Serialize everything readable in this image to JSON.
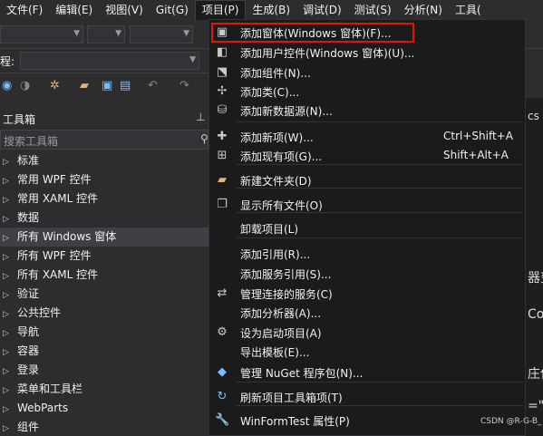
{
  "menubar": {
    "items": [
      "文件(F)",
      "编辑(E)",
      "视图(V)",
      "Git(G)",
      "项目(P)",
      "生成(B)",
      "调试(D)",
      "测试(S)",
      "分析(N)",
      "工具("
    ]
  },
  "toolbar2": {
    "label": "程:"
  },
  "toolbox": {
    "title": "工具箱",
    "search_placeholder": "搜索工具箱",
    "items": [
      "标准",
      "常用 WPF 控件",
      "常用 XAML 控件",
      "数据",
      "所有 Windows 窗体",
      "所有 WPF 控件",
      "所有 XAML 控件",
      "验证",
      "公共控件",
      "导航",
      "容器",
      "登录",
      "菜单和工具栏",
      "WebParts",
      "组件"
    ],
    "selected_index": 4
  },
  "project_menu": {
    "items": [
      {
        "label": "添加窗体(Windows 窗体)(F)...",
        "icon": "add-form-icon",
        "shortcut": ""
      },
      {
        "label": "添加用户控件(Windows 窗体)(U)...",
        "icon": "add-user-control-icon",
        "shortcut": ""
      },
      {
        "label": "添加组件(N)...",
        "icon": "add-component-icon",
        "shortcut": ""
      },
      {
        "label": "添加类(C)...",
        "icon": "add-class-icon",
        "shortcut": ""
      },
      {
        "label": "添加新数据源(N)...",
        "icon": "add-data-source-icon",
        "shortcut": ""
      },
      {
        "label": "添加新项(W)...",
        "icon": "add-new-item-icon",
        "shortcut": "Ctrl+Shift+A"
      },
      {
        "label": "添加现有项(G)...",
        "icon": "add-existing-item-icon",
        "shortcut": "Shift+Alt+A"
      },
      {
        "label": "新建文件夹(D)",
        "icon": "new-folder-icon",
        "shortcut": ""
      },
      {
        "label": "显示所有文件(O)",
        "icon": "show-all-files-icon",
        "shortcut": ""
      },
      {
        "label": "卸载项目(L)",
        "icon": "",
        "shortcut": ""
      },
      {
        "label": "添加引用(R)...",
        "icon": "",
        "shortcut": ""
      },
      {
        "label": "添加服务引用(S)...",
        "icon": "",
        "shortcut": ""
      },
      {
        "label": "管理连接的服务(C)",
        "icon": "connected-services-icon",
        "shortcut": ""
      },
      {
        "label": "添加分析器(A)...",
        "icon": "",
        "shortcut": ""
      },
      {
        "label": "设为启动项目(A)",
        "icon": "gear-icon",
        "shortcut": ""
      },
      {
        "label": "导出模板(E)...",
        "icon": "",
        "shortcut": ""
      },
      {
        "label": "管理 NuGet 程序包(N)...",
        "icon": "nuget-icon",
        "shortcut": ""
      },
      {
        "label": "刷新项目工具箱项(T)",
        "icon": "refresh-icon",
        "shortcut": ""
      },
      {
        "label": "WinFormTest 属性(P)",
        "icon": "wrench-icon",
        "shortcut": ""
      }
    ]
  },
  "editor_fragments": {
    "a": "cs",
    "b": "器变",
    "c": "Co",
    "d": "庄使",
    "e": "=\""
  },
  "watermark": "CSDN @R-G-B_",
  "colors": {
    "highlight": "#e51400",
    "menu_bg": "#1b1b1c"
  }
}
